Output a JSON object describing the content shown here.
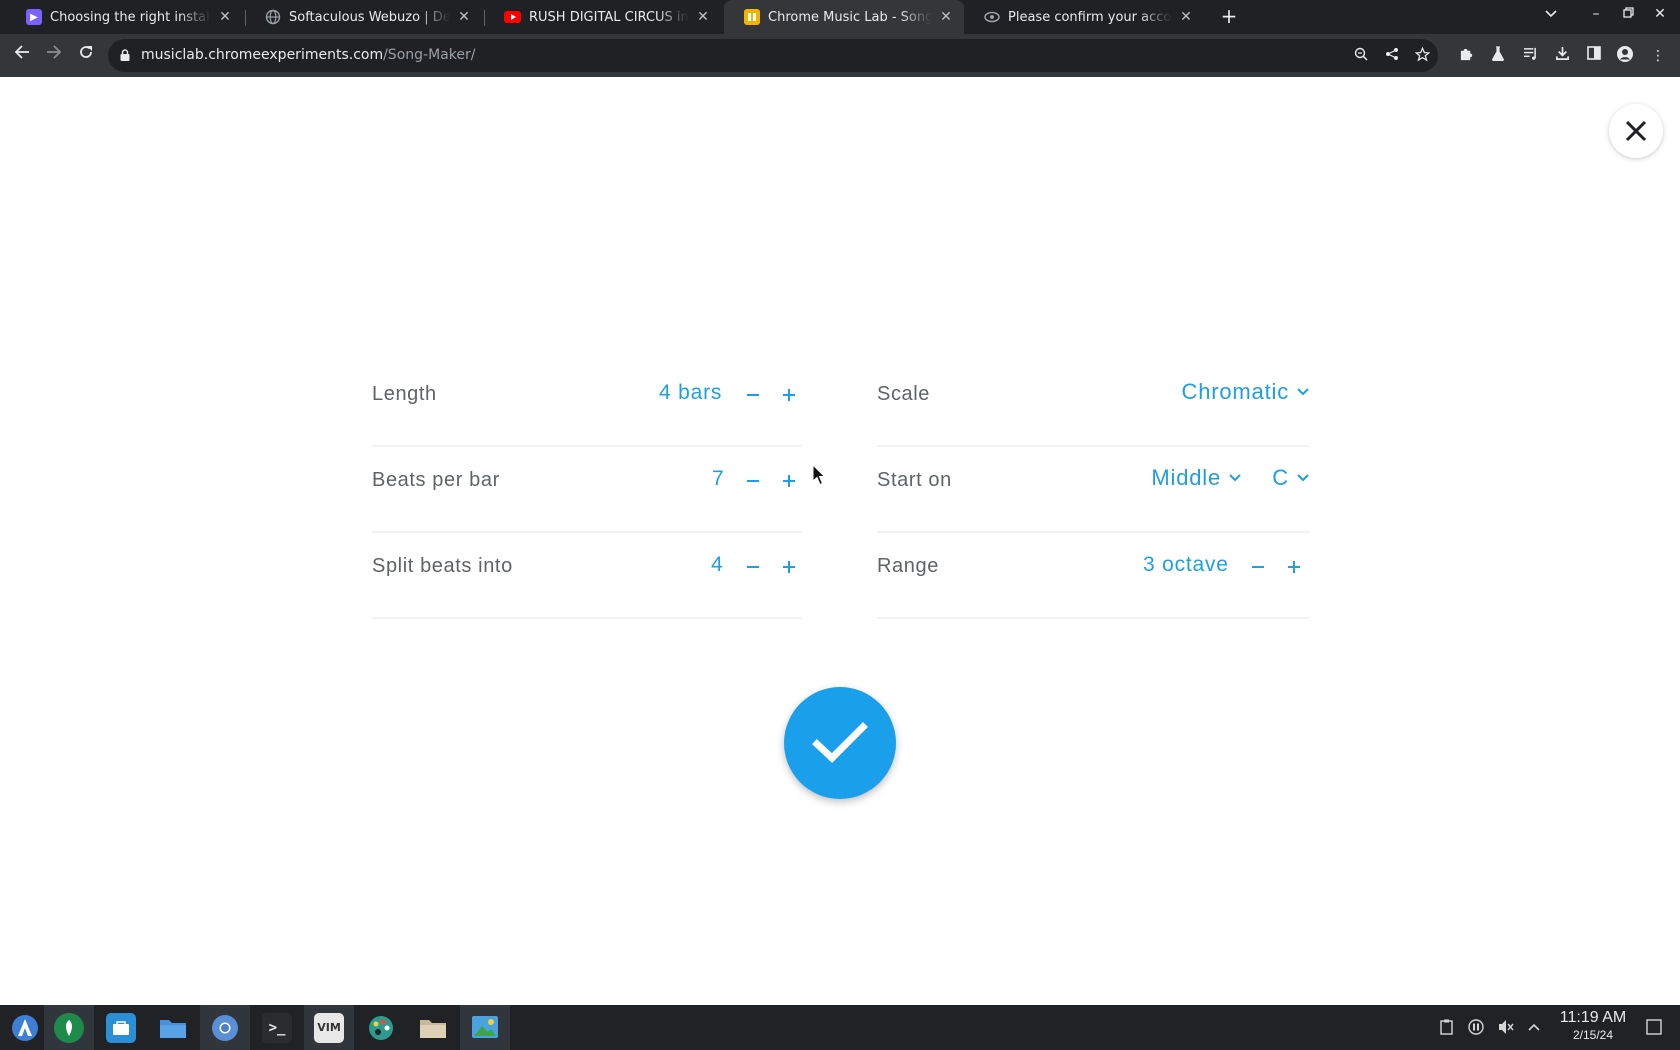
{
  "browser": {
    "tabs": [
      {
        "title": "Choosing the right installatio",
        "icon": "app-favicon",
        "color": "#7b61ff",
        "active": false
      },
      {
        "title": "Softaculous Webuzo | Defau",
        "icon": "globe-favicon",
        "color": "#9aa0a6",
        "active": false
      },
      {
        "title": "RUSH DIGITAL CIRCUS in ch",
        "icon": "youtube-favicon",
        "color": "#ff0000",
        "active": false
      },
      {
        "title": "Chrome Music Lab - Song M",
        "icon": "music-lab-favicon",
        "color": "#f4b400",
        "active": true
      },
      {
        "title": "Please confirm your accoun",
        "icon": "mail-favicon",
        "color": "#9aa0a6",
        "active": false
      }
    ],
    "url_host": "musiclab.chromeexperiments.com",
    "url_path": "/Song-Maker/"
  },
  "settings": {
    "length": {
      "label": "Length",
      "value": "4 bars"
    },
    "beats_per_bar": {
      "label": "Beats per bar",
      "value": "7"
    },
    "split_beats": {
      "label": "Split beats into",
      "value": "4"
    },
    "scale": {
      "label": "Scale",
      "value": "Chromatic"
    },
    "start_on": {
      "label": "Start on",
      "octave": "Middle",
      "note": "C"
    },
    "range": {
      "label": "Range",
      "value": "3 octave"
    }
  },
  "accent_color": "#1d9fe4",
  "taskbar": {
    "apps": [
      "launcher",
      "vpn",
      "store",
      "files",
      "chrome",
      "terminal",
      "vim",
      "paint",
      "folder",
      "image-viewer"
    ],
    "time": "11:19 AM",
    "date": "2/15/24"
  }
}
